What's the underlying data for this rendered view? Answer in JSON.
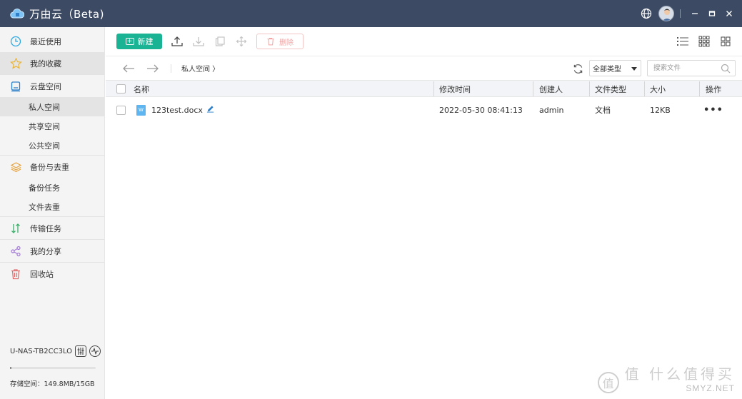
{
  "app": {
    "title": "万由云（Beta)"
  },
  "sidebar": {
    "items": [
      {
        "label": "最近使用"
      },
      {
        "label": "我的收藏"
      },
      {
        "label": "云盘空间"
      },
      {
        "label": "私人空间"
      },
      {
        "label": "共享空间"
      },
      {
        "label": "公共空间"
      },
      {
        "label": "备份与去重"
      },
      {
        "label": "备份任务"
      },
      {
        "label": "文件去重"
      },
      {
        "label": "传输任务"
      },
      {
        "label": "我的分享"
      },
      {
        "label": "回收站"
      }
    ],
    "device_name": "U-NAS-TB2CC3LO",
    "storage_text": "存储空间：149.8MB/15GB",
    "storage_used_fraction": 0.01
  },
  "toolbar": {
    "new_label": "新建",
    "delete_label": "删除"
  },
  "path": {
    "crumb": "私人空间 〉"
  },
  "filter": {
    "type_value": "全部类型",
    "search_placeholder": "搜索文件"
  },
  "table": {
    "headers": {
      "name": "名称",
      "modified": "修改时间",
      "creator": "创建人",
      "type": "文件类型",
      "size": "大小",
      "actions": "操作"
    },
    "rows": [
      {
        "name": "123test.docx",
        "modified": "2022-05-30 08:41:13",
        "creator": "admin",
        "type": "文档",
        "size": "12KB",
        "actions": "•••"
      }
    ]
  },
  "watermark": {
    "line1": "值 什么值得买",
    "line2": "SMYZ.NET"
  },
  "colors": {
    "titlebar": "#3c4a63",
    "accent": "#1ab394",
    "danger": "#f3a0a0"
  }
}
